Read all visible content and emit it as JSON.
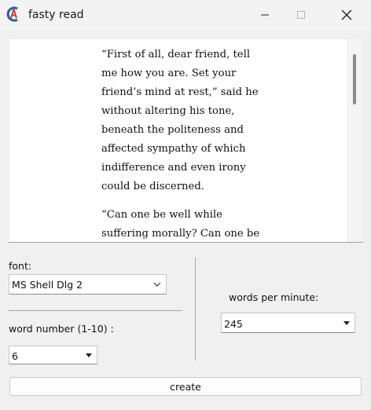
{
  "window": {
    "title": "fasty read"
  },
  "reader": {
    "paragraphs": [
      "“First of all, dear friend, tell me how you are. Set your friend’s mind at rest,” said he without altering his tone, beneath the politeness and affected sympathy of which indifference and even irony could be discerned.",
      "“Can one be well while suffering morally? Can one be calm in"
    ]
  },
  "controls": {
    "font_label": "font:",
    "font_value": "MS Shell Dlg 2",
    "word_number_label": "word number (1-10) :",
    "word_number_value": "6",
    "wpm_label": "words per minute:",
    "wpm_value": "245",
    "create_label": "create"
  }
}
